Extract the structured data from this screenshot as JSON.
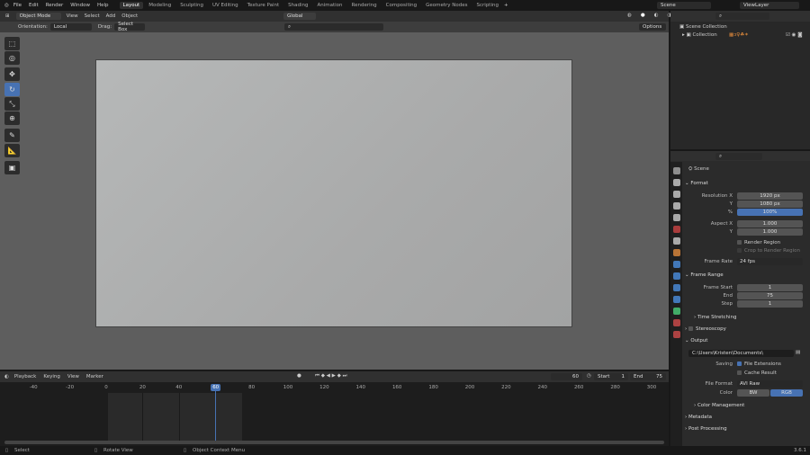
{
  "menu": [
    "File",
    "Edit",
    "Render",
    "Window",
    "Help"
  ],
  "workspaces": [
    "Layout",
    "Modeling",
    "Sculpting",
    "UV Editing",
    "Texture Paint",
    "Shading",
    "Animation",
    "Rendering",
    "Compositing",
    "Geometry Nodes",
    "Scripting"
  ],
  "active_workspace": "Layout",
  "scene": "Scene",
  "view_layer": "ViewLayer",
  "viewport_header": {
    "mode": "Object Mode",
    "menus": [
      "View",
      "Select",
      "Add",
      "Object"
    ],
    "transform": "Global"
  },
  "tool_header": {
    "orientation_label": "Orientation:",
    "orientation": "Local",
    "drag_label": "Drag:",
    "drag": "Select Box",
    "options": "Options"
  },
  "outliner": {
    "scene_collection": "Scene Collection",
    "collection": "Collection"
  },
  "properties": {
    "context": "Scene",
    "format": {
      "title": "Format",
      "res_x_label": "Resolution X",
      "res_x": "1920 px",
      "res_y_label": "Y",
      "res_y": "1080 px",
      "pct_label": "%",
      "pct": "100%",
      "aspect_x_label": "Aspect X",
      "aspect_x": "1.000",
      "aspect_y_label": "Y",
      "aspect_y": "1.000",
      "render_region": "Render Region",
      "crop": "Crop to Render Region",
      "frame_rate_label": "Frame Rate",
      "frame_rate": "24 fps"
    },
    "frame_range": {
      "title": "Frame Range",
      "start_label": "Frame Start",
      "start": "1",
      "end_label": "End",
      "end": "75",
      "step_label": "Step",
      "step": "1"
    },
    "time_stretching": "Time Stretching",
    "stereoscopy": "Stereoscopy",
    "output": {
      "title": "Output",
      "path": "C:\\Users\\Kristen\\Documents\\",
      "saving_label": "Saving",
      "file_ext": "File Extensions",
      "cache": "Cache Result",
      "format_label": "File Format",
      "format": "AVI Raw",
      "color_label": "Color",
      "bw": "BW",
      "rgb": "RGB",
      "color_mgmt": "Color Management"
    },
    "metadata": "Metadata",
    "post": "Post Processing"
  },
  "timeline": {
    "menus": [
      "Playback",
      "Keying",
      "View",
      "Marker"
    ],
    "current": "60",
    "start_label": "Start",
    "start": "1",
    "end_label": "End",
    "end": "75",
    "ticks": [
      "-40",
      "-20",
      "0",
      "20",
      "40",
      "60",
      "80",
      "100",
      "120",
      "140",
      "160",
      "180",
      "200",
      "220",
      "240",
      "260",
      "280",
      "300"
    ],
    "frame_start": 1,
    "frame_end": 75,
    "current_frame": 60
  },
  "status": {
    "select": "Select",
    "rotate": "Rotate View",
    "context": "Object Context Menu",
    "version": "3.6.1"
  }
}
